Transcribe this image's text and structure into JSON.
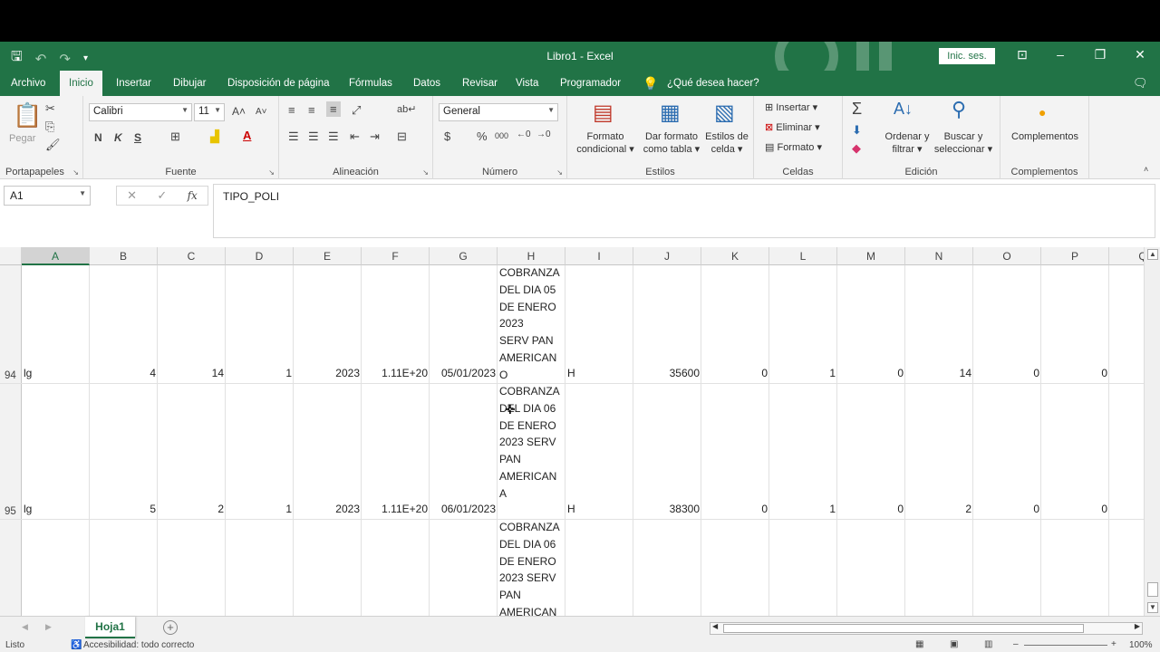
{
  "app": {
    "window_title": "Libro1  -  Excel",
    "sign_in": "Inic. ses."
  },
  "tabs": [
    "Archivo",
    "Inicio",
    "Insertar",
    "Dibujar",
    "Disposición de página",
    "Fórmulas",
    "Datos",
    "Revisar",
    "Vista",
    "Programador"
  ],
  "active_tab": "Inicio",
  "tell_me": "¿Qué desea hacer?",
  "ribbon": {
    "clipboard": {
      "paste": "Pegar",
      "label": "Portapapeles"
    },
    "font": {
      "name": "Calibri",
      "size": "11",
      "bold": "N",
      "italic": "K",
      "underline": "S",
      "label": "Fuente"
    },
    "alignment": {
      "label": "Alineación"
    },
    "number": {
      "format": "General",
      "currency": "$",
      "percent": "%",
      "thousands": "000",
      "label": "Número"
    },
    "styles": {
      "conditional_1": "Formato",
      "conditional_2": "condicional",
      "table_1": "Dar formato",
      "table_2": "como tabla",
      "cell_1": "Estilos de",
      "cell_2": "celda",
      "label": "Estilos"
    },
    "cells": {
      "insert": "Insertar",
      "delete": "Eliminar",
      "format": "Formato",
      "label": "Celdas"
    },
    "editing": {
      "sort_1": "Ordenar y",
      "sort_2": "filtrar",
      "find_1": "Buscar y",
      "find_2": "seleccionar",
      "label": "Edición"
    },
    "addins": {
      "btn": "Complementos",
      "label": "Complementos"
    }
  },
  "formula_bar": {
    "name_box": "A1",
    "fx": "fx",
    "content": "TIPO_POLI"
  },
  "columns": [
    "A",
    "B",
    "C",
    "D",
    "E",
    "F",
    "G",
    "H",
    "I",
    "J",
    "K",
    "L",
    "M",
    "N",
    "O",
    "P",
    "Q"
  ],
  "rows": [
    {
      "num": "94",
      "a": "lg",
      "b": "4",
      "c": "14",
      "d": "1",
      "e": "2023",
      "f": "1.11E+20",
      "g": "05/01/2023",
      "h": "COBRANZA\nDEL DIA 05\nDE ENERO\n2023\nSERV PAN\nAMERICAN\nO",
      "i": "H",
      "j": "35600",
      "k": "0",
      "l": "1",
      "m": "0",
      "n": "14",
      "o": "0",
      "p": "0"
    },
    {
      "num": "95",
      "a": "lg",
      "b": "5",
      "c": "2",
      "d": "1",
      "e": "2023",
      "f": "1.11E+20",
      "g": "06/01/2023",
      "h": "COBRANZA\nDEL DIA 06\nDE ENERO\n2023 SERV\nPAN\nAMERICAN\nA",
      "i": "H",
      "j": "38300",
      "k": "0",
      "l": "1",
      "m": "0",
      "n": "2",
      "o": "0",
      "p": "0"
    },
    {
      "num": "",
      "h": "COBRANZA\nDEL DIA 06\nDE ENERO\n2023 SERV\nPAN\nAMERICAN"
    }
  ],
  "sheet": {
    "name": "Hoja1"
  },
  "status": {
    "ready": "Listo",
    "accessibility": "Accesibilidad: todo correcto",
    "zoom": "100%"
  },
  "colors": {
    "excel_green": "#217346"
  }
}
